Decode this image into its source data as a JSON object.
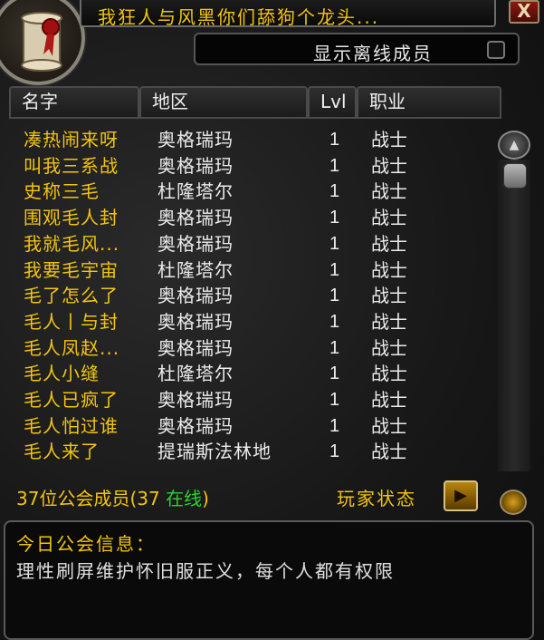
{
  "window": {
    "title": "我狂人与风黑你们舔狗个龙头...",
    "close_label": "X"
  },
  "filter": {
    "show_offline_label": "显示离线成员",
    "show_offline_checked": false
  },
  "columns": {
    "name": "名字",
    "zone": "地区",
    "level": "Lvl",
    "class": "职业"
  },
  "roster": [
    {
      "name": "凑热闹来呀",
      "zone": "奥格瑞玛",
      "level": "1",
      "class": "战士"
    },
    {
      "name": "叫我三系战",
      "zone": "奥格瑞玛",
      "level": "1",
      "class": "战士"
    },
    {
      "name": "史称三毛",
      "zone": "杜隆塔尔",
      "level": "1",
      "class": "战士"
    },
    {
      "name": "围观毛人封",
      "zone": "奥格瑞玛",
      "level": "1",
      "class": "战士"
    },
    {
      "name": "我就毛风...",
      "zone": "奥格瑞玛",
      "level": "1",
      "class": "战士"
    },
    {
      "name": "我要毛宇宙",
      "zone": "杜隆塔尔",
      "level": "1",
      "class": "战士"
    },
    {
      "name": "毛了怎么了",
      "zone": "奥格瑞玛",
      "level": "1",
      "class": "战士"
    },
    {
      "name": "毛人丨与封",
      "zone": "奥格瑞玛",
      "level": "1",
      "class": "战士"
    },
    {
      "name": "毛人凤赵...",
      "zone": "奥格瑞玛",
      "level": "1",
      "class": "战士"
    },
    {
      "name": "毛人小缝",
      "zone": "杜隆塔尔",
      "level": "1",
      "class": "战士"
    },
    {
      "name": "毛人已疯了",
      "zone": "奥格瑞玛",
      "level": "1",
      "class": "战士"
    },
    {
      "name": "毛人怕过谁",
      "zone": "奥格瑞玛",
      "level": "1",
      "class": "战士"
    },
    {
      "name": "毛人来了",
      "zone": "提瑞斯法林地",
      "level": "1",
      "class": "战士"
    }
  ],
  "footer": {
    "members_prefix": "37位公会成员(37 ",
    "online_word": "在线",
    "members_suffix": ")",
    "player_status_label": "玩家状态"
  },
  "motd": {
    "title": "今日公会信息：",
    "text": "理性刷屏维护怀旧服正义，每个人都有权限"
  },
  "icons": {
    "emblem": "guild-scroll-icon",
    "scroll_up": "scroll-up-icon",
    "status_arrow": "play-arrow-icon"
  },
  "colors": {
    "name_gold": "#f2c50f",
    "online_green": "#2fd12f",
    "text_white": "#ececec"
  }
}
